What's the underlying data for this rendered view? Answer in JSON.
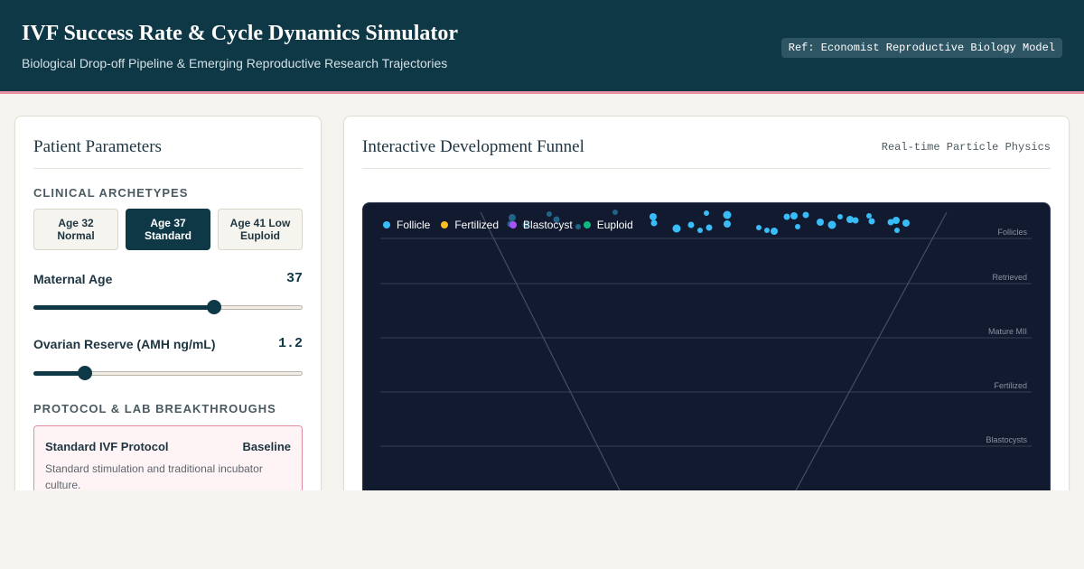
{
  "header": {
    "title": "IVF Success Rate & Cycle Dynamics Simulator",
    "subtitle": "Biological Drop-off Pipeline & Emerging Reproductive Research Trajectories",
    "ref": "Ref: Economist Reproductive Biology Model"
  },
  "left": {
    "title": "Patient Parameters",
    "archetypes_label": "CLINICAL ARCHETYPES",
    "archetypes": [
      {
        "label": "Age 32 Normal",
        "active": false
      },
      {
        "label": "Age 37 Standard",
        "active": true
      },
      {
        "label": "Age 41 Low Euploid",
        "active": false
      }
    ],
    "maternal_age": {
      "label": "Maternal Age",
      "value": "37",
      "fraction": 0.67
    },
    "amh": {
      "label": "Ovarian Reserve (AMH ng/mL)",
      "value": "1.2",
      "fraction": 0.19
    },
    "protocols_label": "PROTOCOL & LAB BREAKTHROUGHS",
    "protocol": {
      "name": "Standard IVF Protocol",
      "badge": "Baseline",
      "description": "Standard stimulation and traditional incubator culture."
    }
  },
  "right": {
    "title": "Interactive Development Funnel",
    "tag": "Real-time Particle Physics",
    "legend": [
      {
        "label": "Follicle",
        "color": "#38bdf8"
      },
      {
        "label": "Fertilized",
        "color": "#fbbf24"
      },
      {
        "label": "Blastocyst",
        "color": "#a855f7"
      },
      {
        "label": "Euploid",
        "color": "#10b981"
      }
    ],
    "stages": [
      "Follicles",
      "Retrieved",
      "Mature MII",
      "Fertilized",
      "Blastocysts"
    ]
  },
  "colors": {
    "header_bg": "#0f3846",
    "accent_pink": "#e88fa0",
    "panel_bg": "#111a2e",
    "particle": "#38bdf8"
  }
}
